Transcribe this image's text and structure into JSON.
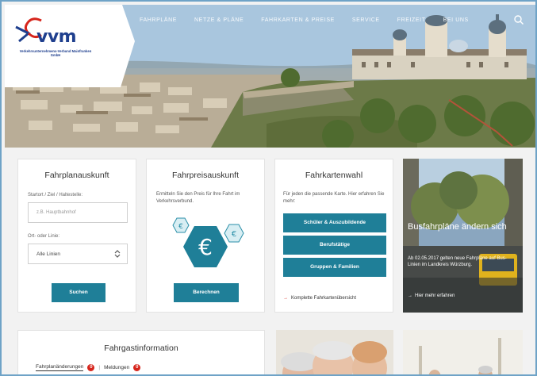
{
  "logo": {
    "wordmark": "vvm",
    "subtitle": "Verkehrsunternehmens-Verbund Mainfranken GmbH"
  },
  "nav": {
    "items": [
      {
        "label": "Fahrpläne"
      },
      {
        "label": "Netze & Pläne"
      },
      {
        "label": "Fahrkarten & Preise"
      },
      {
        "label": "Service"
      },
      {
        "label": "Freizeit"
      },
      {
        "label": "Bei uns"
      }
    ]
  },
  "fahrplan": {
    "title": "Fahrplanauskunft",
    "start_label": "Startort / Ziel / Haltestelle:",
    "start_placeholder": "z.B. Hauptbahnhof",
    "line_label": "Ort- oder Linie:",
    "line_value": "Alle Linien",
    "submit": "Suchen"
  },
  "preis": {
    "title": "Fahrpreisauskunft",
    "description": "Ermitteln Sie den Preis für Ihre Fahrt im Verkehrsverbund.",
    "icon_symbol": "€",
    "submit": "Berechnen"
  },
  "karten": {
    "title": "Fahrkartenwahl",
    "description": "Für jeden die passende Karte. Hier erfahren Sie mehr:",
    "buttons": [
      {
        "label": "Schüler & Auszubildende"
      },
      {
        "label": "Berufstätige"
      },
      {
        "label": "Gruppen & Familien"
      }
    ],
    "link": "Komplette Fahrkartenübersicht"
  },
  "news": {
    "headline": "Busfahrpläne ändern sich",
    "body": "Ab 02.05.2017 gelten neue Fahrpläne auf Bus-Linien im Landkreis Würzburg.",
    "link": "Hier mehr erfahren"
  },
  "info": {
    "title": "Fahrgastinformation",
    "tab1": "Fahrplanänderungen",
    "tab1_count": "0",
    "tab2": "Meldungen",
    "tab2_count": "0"
  },
  "colors": {
    "accent": "#1f7f98",
    "brand_blue": "#1f3f8e",
    "alert_red": "#d6251c"
  }
}
